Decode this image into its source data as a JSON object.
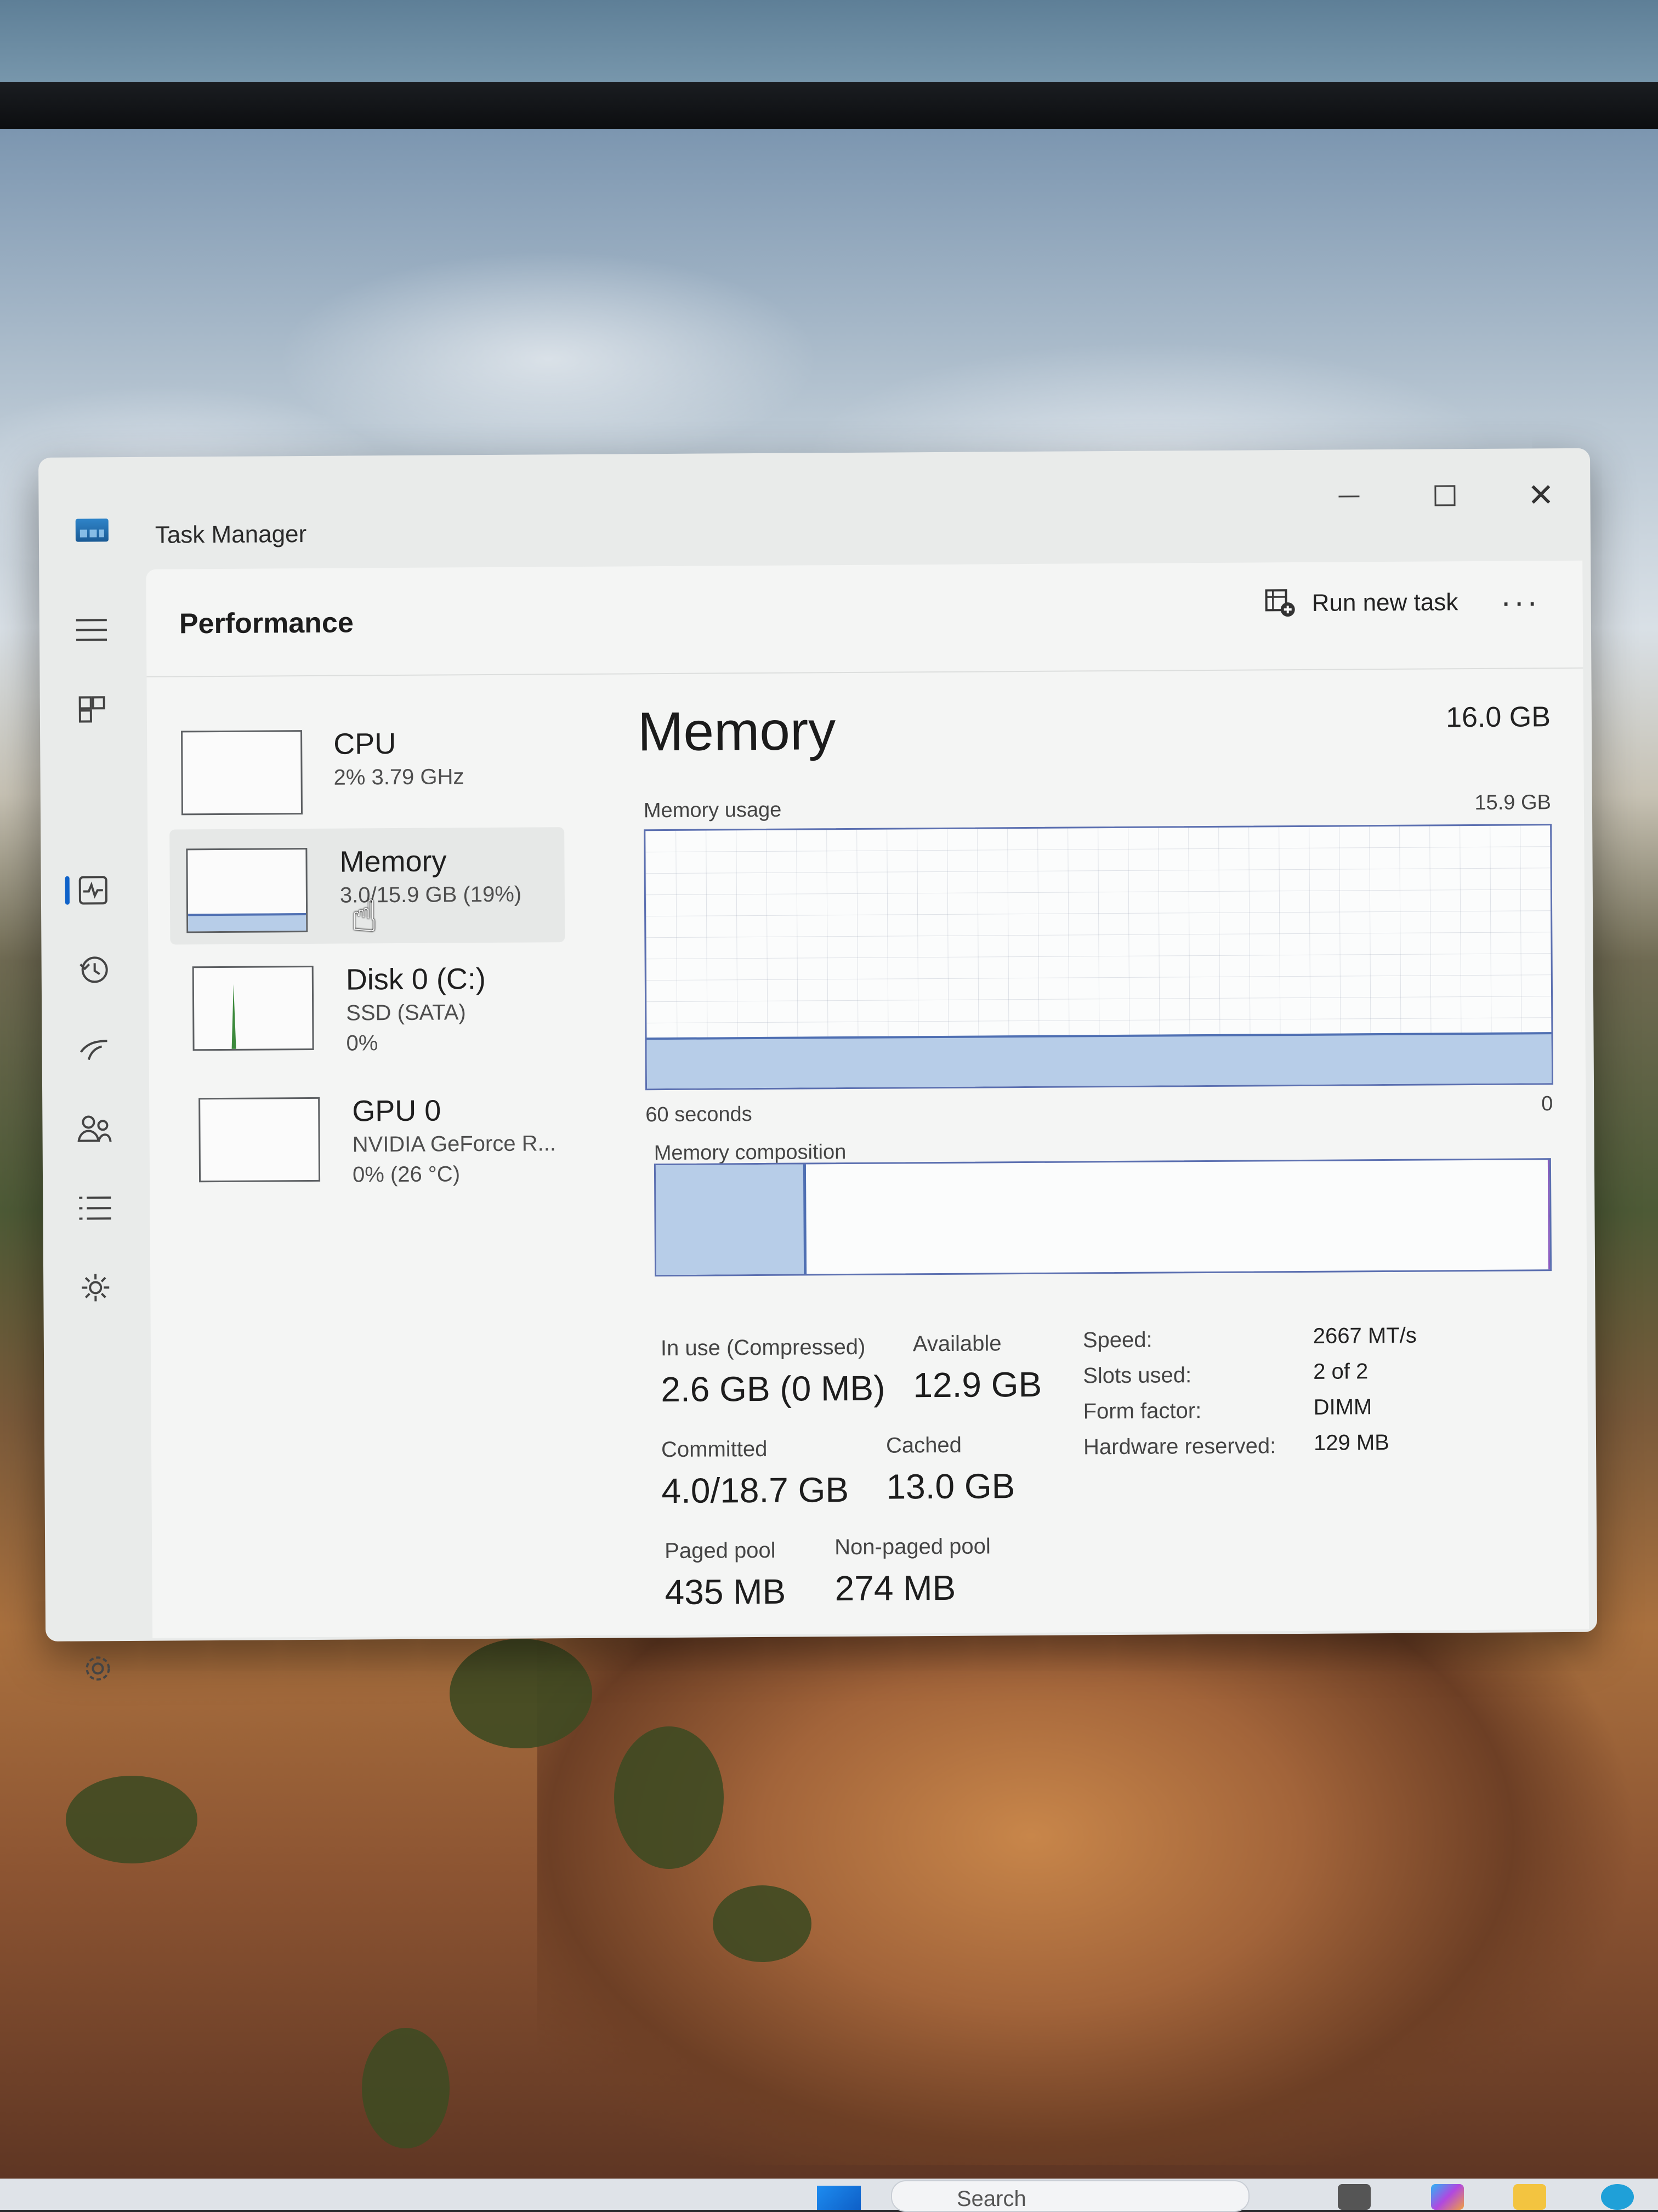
{
  "window": {
    "title": "Task Manager"
  },
  "header": {
    "page_title": "Performance",
    "run_new_task_label": "Run new task",
    "more_label": "···"
  },
  "nav": {
    "items": [
      "hamburger-menu-icon",
      "processes-icon",
      "performance-icon",
      "app-history-icon",
      "startup-apps-icon",
      "users-icon",
      "details-icon",
      "services-icon",
      "settings-icon"
    ],
    "selected": "performance-icon"
  },
  "resources": [
    {
      "name": "CPU",
      "sub1": "2% 3.79 GHz",
      "sub2": "",
      "sub3": ""
    },
    {
      "name": "Memory",
      "sub1": "3.0/15.9 GB (19%)",
      "sub2": "",
      "sub3": "",
      "usage_fraction": 0.19
    },
    {
      "name": "Disk 0 (C:)",
      "sub1": "SSD (SATA)",
      "sub2": "0%",
      "sub3": ""
    },
    {
      "name": "GPU 0",
      "sub1": "NVIDIA GeForce R...",
      "sub2": "0% (26 °C)",
      "sub3": ""
    }
  ],
  "memory": {
    "title": "Memory",
    "total": "16.0 GB",
    "usage_label": "Memory usage",
    "usage_max": "15.9 GB",
    "axis_left": "60 seconds",
    "axis_right": "0",
    "composition_label": "Memory composition",
    "composition_in_use_fraction": 0.165,
    "stats": {
      "in_use_label": "In use (Compressed)",
      "in_use_value": "2.6 GB (0 MB)",
      "available_label": "Available",
      "available_value": "12.9 GB",
      "committed_label": "Committed",
      "committed_value": "4.0/18.7 GB",
      "cached_label": "Cached",
      "cached_value": "13.0 GB",
      "paged_label": "Paged pool",
      "paged_value": "435 MB",
      "nonpaged_label": "Non-paged pool",
      "nonpaged_value": "274 MB"
    },
    "specs": [
      {
        "label": "Speed:",
        "value": "2667 MT/s"
      },
      {
        "label": "Slots used:",
        "value": "2 of 2"
      },
      {
        "label": "Form factor:",
        "value": "DIMM"
      },
      {
        "label": "Hardware reserved:",
        "value": "129 MB"
      }
    ]
  },
  "taskbar": {
    "search_label": "Search"
  },
  "colors": {
    "graph_border": "#5b6fb0",
    "graph_fill": "#b7cde8",
    "accent": "#0f62c9"
  }
}
